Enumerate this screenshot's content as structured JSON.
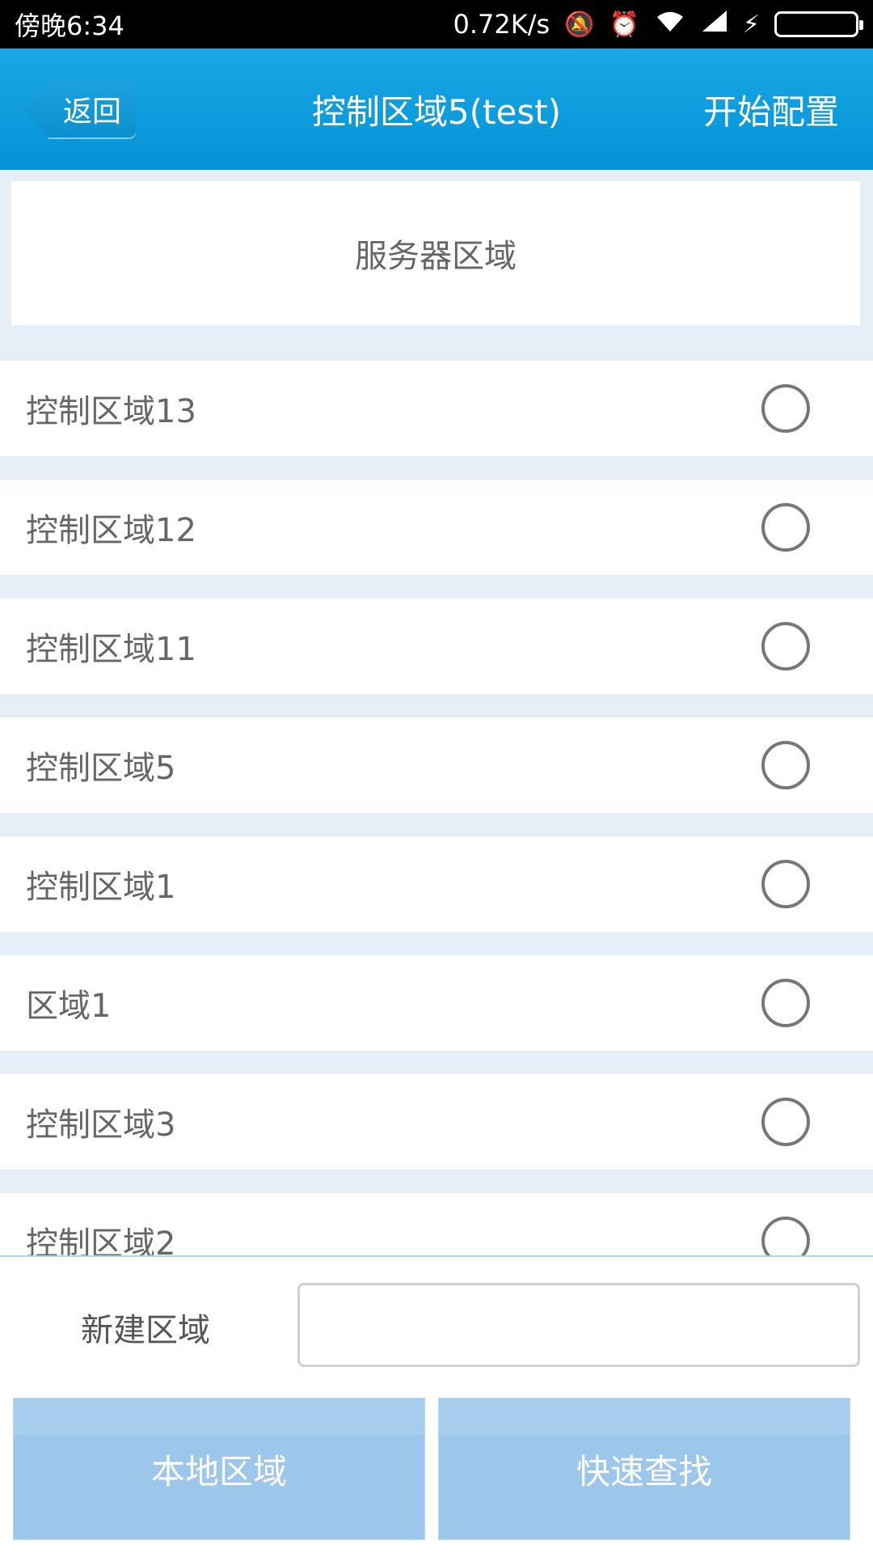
{
  "status_bar": {
    "time": "傍晚6:34",
    "net_speed": "0.72K/s"
  },
  "header": {
    "back_label": "返回",
    "title": "控制区域5(test)",
    "action_label": "开始配置"
  },
  "server_section": {
    "label": "服务器区域"
  },
  "areas": [
    {
      "label": "控制区域13",
      "selected": false
    },
    {
      "label": "控制区域12",
      "selected": false
    },
    {
      "label": "控制区域11",
      "selected": false
    },
    {
      "label": "控制区域5",
      "selected": false
    },
    {
      "label": "控制区域1",
      "selected": false
    },
    {
      "label": "区域1",
      "selected": false
    },
    {
      "label": "控制区域3",
      "selected": false
    },
    {
      "label": "控制区域2",
      "selected": false
    }
  ],
  "bottom": {
    "new_area_label": "新建区域",
    "new_area_value": "",
    "local_button": "本地区域",
    "search_button": "快速查找"
  }
}
